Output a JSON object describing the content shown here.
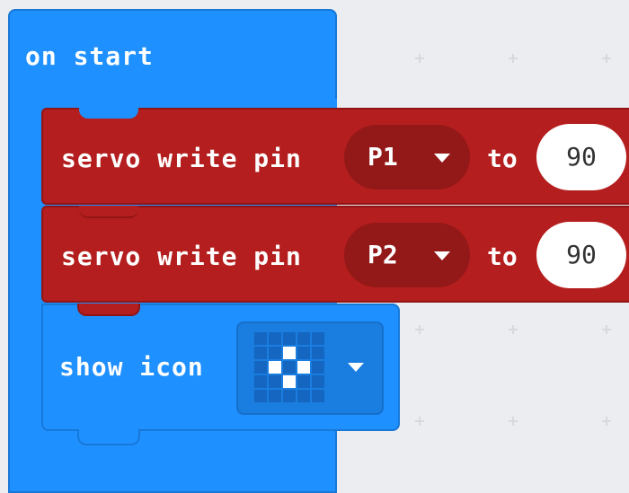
{
  "workspace": {
    "background": "#ebedf0"
  },
  "on_start": {
    "label": "on start",
    "color": "#1e90ff"
  },
  "servo_blocks": [
    {
      "label": "servo write pin",
      "pin": "P1",
      "to_label": "to",
      "value": "90"
    },
    {
      "label": "servo write pin",
      "pin": "P2",
      "to_label": "to",
      "value": "90"
    }
  ],
  "servo_color": "#b41e1e",
  "show_icon": {
    "label": "show icon",
    "icon_leds_on": [
      [
        0,
        0,
        0,
        0,
        0
      ],
      [
        0,
        0,
        1,
        0,
        0
      ],
      [
        0,
        1,
        0,
        1,
        0
      ],
      [
        0,
        0,
        1,
        0,
        0
      ],
      [
        0,
        0,
        0,
        0,
        0
      ]
    ]
  },
  "icons": {
    "dropdown": "chevron-down-icon"
  }
}
